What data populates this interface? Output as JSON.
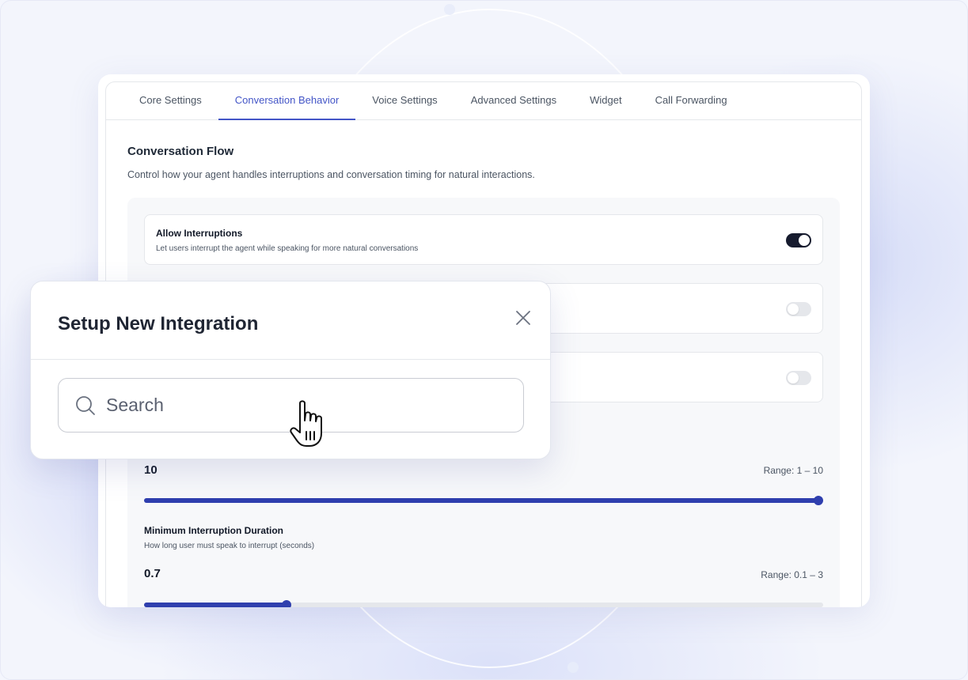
{
  "tabs": [
    {
      "label": "Core Settings"
    },
    {
      "label": "Conversation Behavior"
    },
    {
      "label": "Voice Settings"
    },
    {
      "label": "Advanced Settings"
    },
    {
      "label": "Widget"
    },
    {
      "label": "Call Forwarding"
    }
  ],
  "active_tab": "Conversation Behavior",
  "section": {
    "title": "Conversation Flow",
    "description": "Control how your agent handles interruptions and conversation timing for natural interactions."
  },
  "options": [
    {
      "title": "Allow Interruptions",
      "description": "Let users interrupt the agent while speaking for more natural conversations",
      "enabled": true
    },
    {
      "enabled": false
    },
    {
      "enabled": false
    }
  ],
  "sliders": [
    {
      "value": "10",
      "range_label": "Range: 1 – 10",
      "fraction": 1.0
    },
    {
      "title": "Minimum Interruption Duration",
      "description": "How long user must speak to interrupt (seconds)",
      "value": "0.7",
      "range_label": "Range: 0.1 – 3",
      "fraction": 0.21
    }
  ],
  "modal": {
    "title": "Setup New Integration",
    "search_placeholder": "Search"
  },
  "colors": {
    "accent": "#4355c7",
    "slider": "#2f3fae",
    "toggle_on": "#161b2e"
  },
  "icons": [
    "close-icon",
    "search-icon",
    "hand-pointer-cursor-icon"
  ]
}
